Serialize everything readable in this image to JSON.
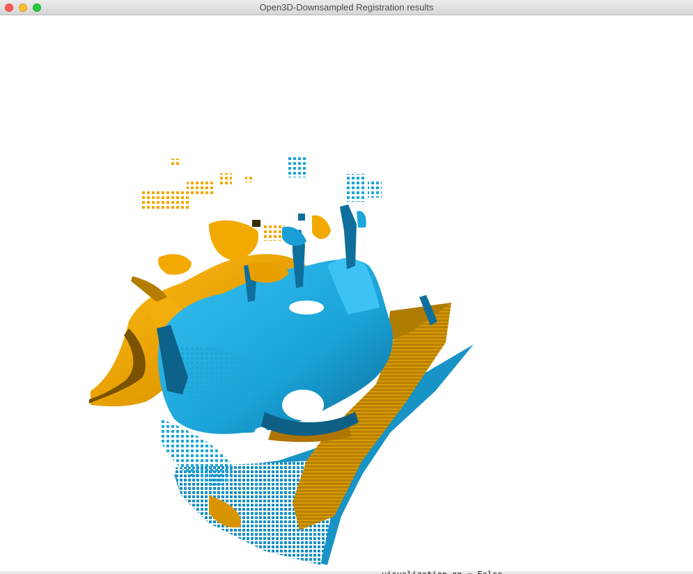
{
  "window": {
    "title": "Open3D-Downsampled Registration results"
  },
  "colors": {
    "source_cloud": "#1ba8dc",
    "target_cloud": "#f2a900",
    "background": "#ffffff"
  },
  "background_code_snippet": "visualization_on = False"
}
